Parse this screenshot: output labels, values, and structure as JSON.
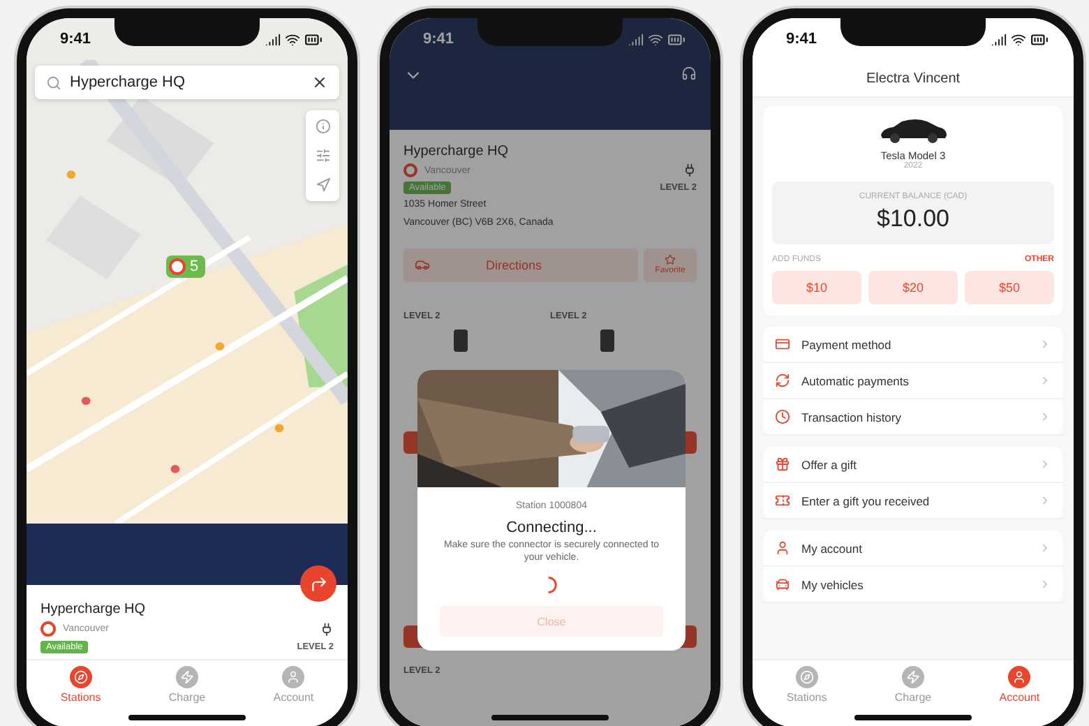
{
  "phone_stations": {
    "status_time": "9:41",
    "search": {
      "value": "Hypercharge HQ"
    },
    "pin": {
      "count": "5"
    },
    "station": {
      "name": "Hypercharge HQ",
      "operator": "Vancouver",
      "status": "Available",
      "level": "LEVEL 2"
    },
    "tabs": [
      {
        "kind": "stations",
        "label": "Stations",
        "selected": true
      },
      {
        "kind": "charge",
        "label": "Charge",
        "selected": false
      },
      {
        "kind": "account",
        "label": "Account",
        "selected": false
      }
    ]
  },
  "phone_connecting": {
    "status_time": "9:41",
    "station": {
      "name": "Hypercharge HQ",
      "operator": "Vancouver",
      "status": "Available",
      "level": "LEVEL 2",
      "address": [
        "1035 Homer Street",
        "Vancouver (BC) V6B 2X6, Canada"
      ]
    },
    "actions": {
      "directions": "Directions",
      "favorite": "Favorite"
    },
    "connectors": [
      {
        "label": "LEVEL 2"
      },
      {
        "label": "LEVEL 2"
      }
    ],
    "footer_label": "LEVEL 2",
    "modal": {
      "station": "Station 1000804",
      "title": "Connecting...",
      "message": "Make sure the connector is securely connected to your vehicle.",
      "button": "Close"
    }
  },
  "phone_account": {
    "status_time": "9:41",
    "title": "Electra Vincent",
    "vehicle": {
      "model": "Tesla Model 3",
      "year": "2022"
    },
    "balance": {
      "label": "CURRENT BALANCE (CAD)",
      "amount": "$10.00"
    },
    "add_funds": {
      "label": "ADD FUNDS",
      "other": "OTHER",
      "amounts": [
        "$10",
        "$20",
        "$50"
      ]
    },
    "menu_groups": [
      [
        {
          "kind": "card",
          "label": "Payment method"
        },
        {
          "kind": "auto",
          "label": "Automatic payments"
        },
        {
          "kind": "history",
          "label": "Transaction history"
        }
      ],
      [
        {
          "kind": "gift",
          "label": "Offer a gift"
        },
        {
          "kind": "voucher",
          "label": "Enter a gift you received"
        }
      ],
      [
        {
          "kind": "account",
          "label": "My account"
        },
        {
          "kind": "vehicles",
          "label": "My vehicles"
        }
      ]
    ],
    "tabs": [
      {
        "kind": "stations",
        "label": "Stations",
        "selected": false
      },
      {
        "kind": "charge",
        "label": "Charge",
        "selected": false
      },
      {
        "kind": "account",
        "label": "Account",
        "selected": true
      }
    ]
  }
}
